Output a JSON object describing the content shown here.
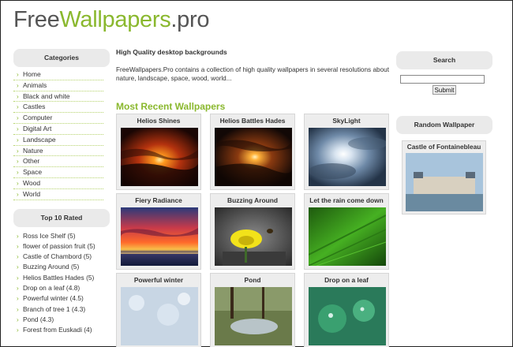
{
  "logo": {
    "part1": "Free",
    "part2": "Wallpapers",
    "part3": ".pro"
  },
  "colors": {
    "accent": "#8ab82e",
    "box_bg": "#eaeaea",
    "thumb_bg": "#ededed"
  },
  "sidebar": {
    "categories_title": "Categories",
    "categories": [
      "Home",
      "Animals",
      "Black and white",
      "Castles",
      "Computer",
      "Digital Art",
      "Landscape",
      "Nature",
      "Other",
      "Space",
      "Wood",
      "World"
    ],
    "rated_title": "Top 10 Rated",
    "rated": [
      "Ross Ice Shelf (5)",
      "flower of passion fruit (5)",
      "Castle of Chambord (5)",
      "Buzzing Around (5)",
      "Helios Battles Hades (5)",
      "Drop on a leaf (4.8)",
      "Powerful winter (4.5)",
      "Branch of tree 1 (4.3)",
      "Pond (4.3)",
      "Forest from Euskadi (4)"
    ]
  },
  "main": {
    "headline": "High Quality desktop backgrounds",
    "intro": "FreeWallpapers.Pro contains a collection of high quality wallpapers in several resolutions about nature, landscape, space, wood, world...",
    "recent_title": "Most Recent Wallpapers",
    "wallpapers": [
      {
        "title": "Helios Shines",
        "icon": "sunset-image"
      },
      {
        "title": "Helios Battles Hades",
        "icon": "sun-clouds-image"
      },
      {
        "title": "SkyLight",
        "icon": "sky-clouds-image"
      },
      {
        "title": "Fiery Radiance",
        "icon": "sea-sunset-image"
      },
      {
        "title": "Buzzing Around",
        "icon": "flower-bee-image"
      },
      {
        "title": "Let the rain come down",
        "icon": "green-leaf-image"
      },
      {
        "title": "Powerful winter",
        "icon": "snow-image"
      },
      {
        "title": "Pond",
        "icon": "pond-image"
      },
      {
        "title": "Drop on a leaf",
        "icon": "leaf-drops-image"
      }
    ]
  },
  "right": {
    "search_title": "Search",
    "search_value": "",
    "submit_label": "Submit",
    "random_title": "Random Wallpaper",
    "random_item": {
      "title": "Castle of Fontainebleau",
      "icon": "castle-image"
    }
  }
}
